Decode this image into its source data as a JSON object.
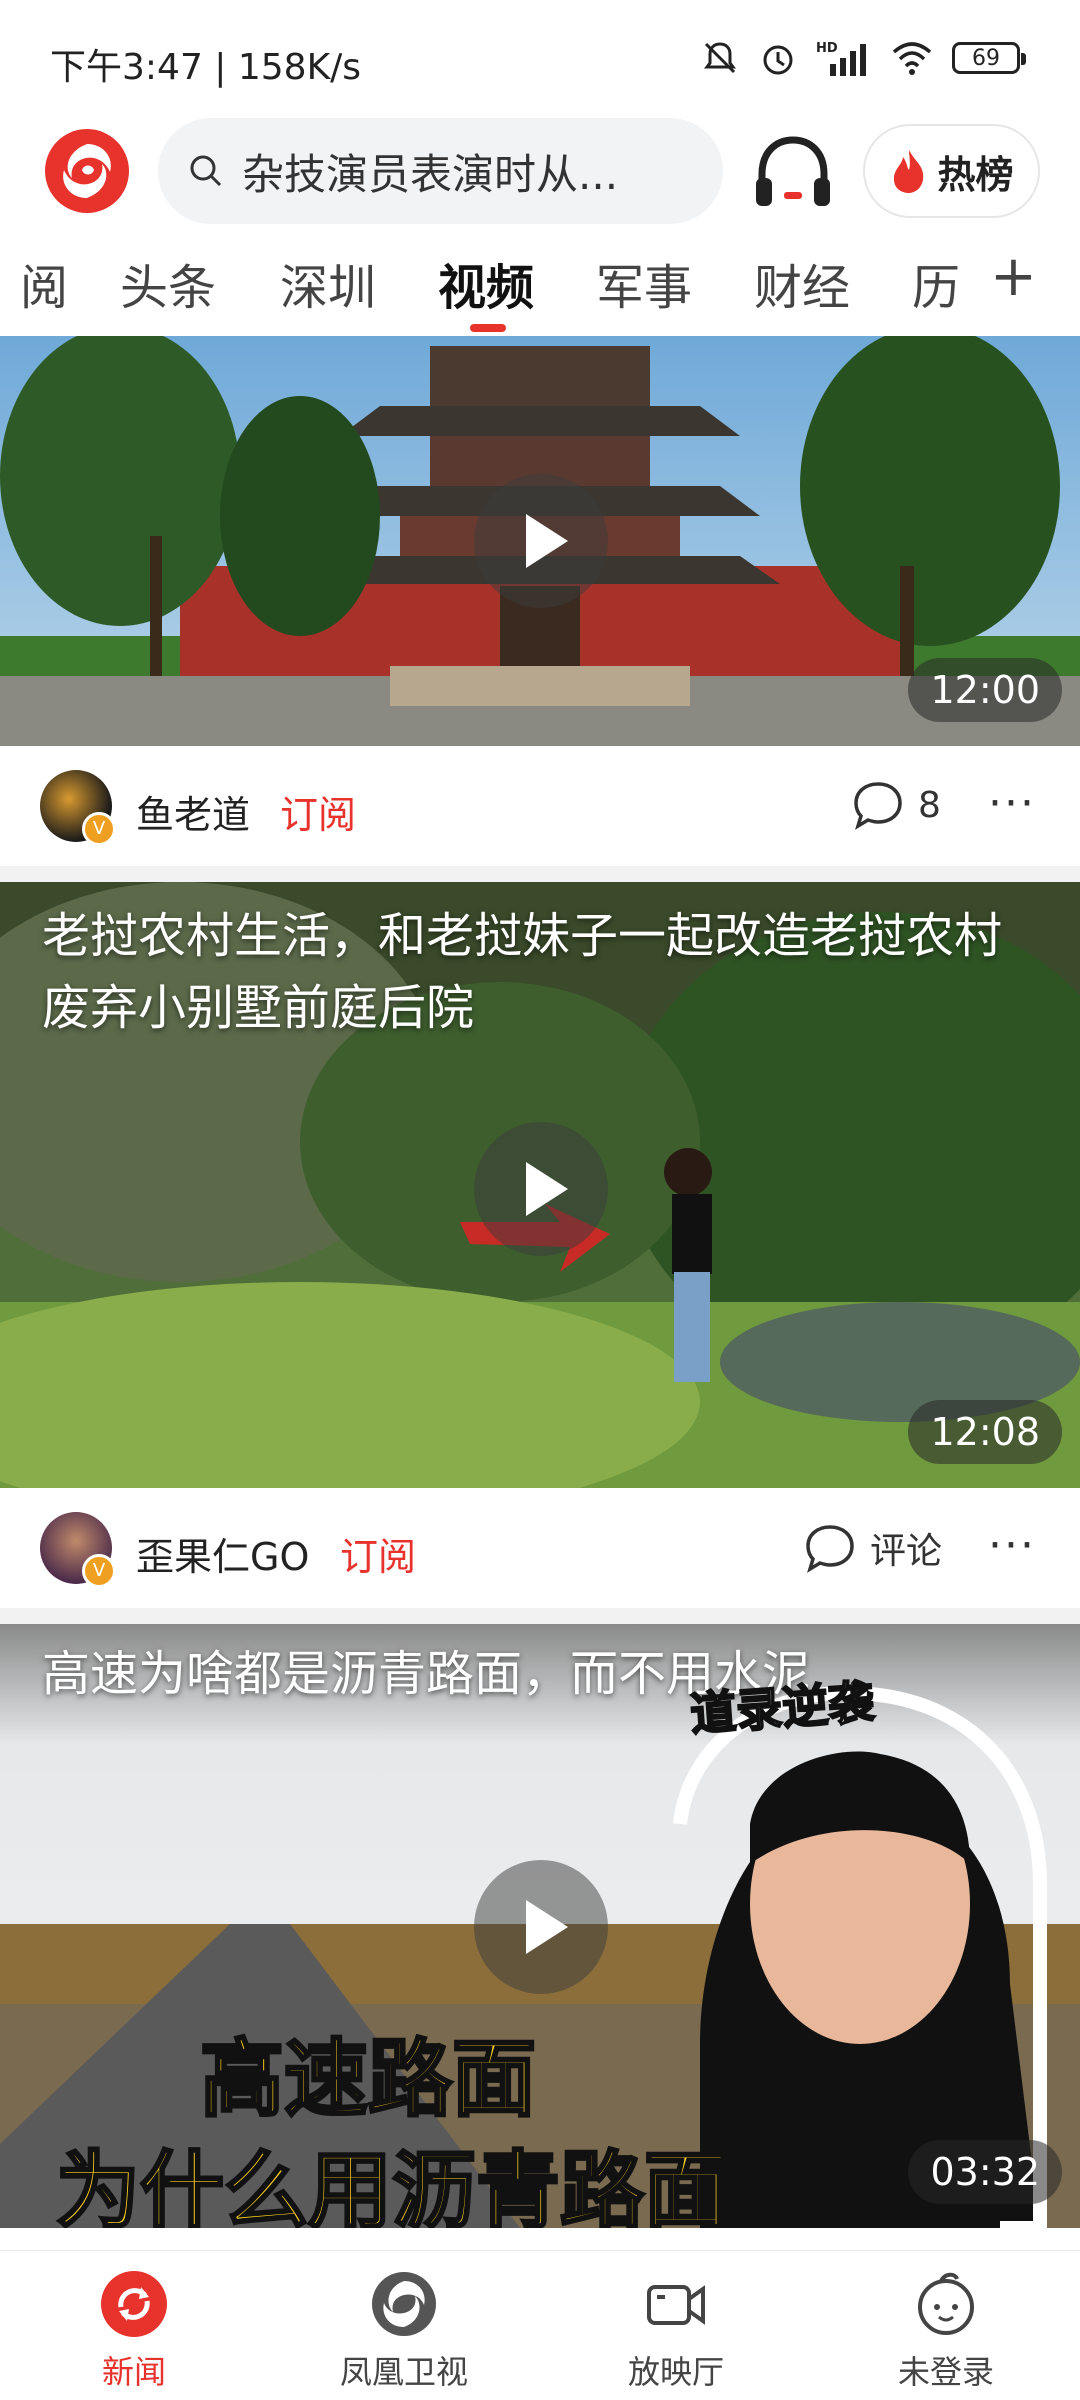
{
  "status_bar": {
    "time_speed": "下午3:47 | 158K/s",
    "battery": "69",
    "icons": [
      "mute-bell-icon",
      "alarm-icon",
      "hd-signal-icon",
      "wifi-icon",
      "battery-icon"
    ]
  },
  "header": {
    "logo": "ifeng-logo",
    "search_text": "杂技演员表演时从...",
    "hot_label": "热榜",
    "accent_color": "#e8322c"
  },
  "tabs": {
    "items": [
      "阅",
      "头条",
      "深圳",
      "视频",
      "军事",
      "财经",
      "历"
    ],
    "active": "视频"
  },
  "feed": [
    {
      "author": "鱼老道",
      "subscribe": "订阅",
      "comments": "8",
      "duration": "12:00"
    },
    {
      "title": "老挝农村生活，和老挝妹子一起改造老挝农村废弃小别墅前庭后院",
      "author": "歪果仁GO",
      "subscribe": "订阅",
      "comments": "评论",
      "duration": "12:08"
    },
    {
      "title": "高速为啥都是沥青路面，而不用水泥",
      "overlay_tag": "道录逆袭",
      "big_caption_1": "高速路面",
      "big_caption_2": "为什么用沥青路面",
      "duration": "03:32"
    }
  ],
  "bottom_nav": {
    "items": [
      "新闻",
      "凤凰卫视",
      "放映厅",
      "未登录"
    ],
    "active": "新闻"
  }
}
